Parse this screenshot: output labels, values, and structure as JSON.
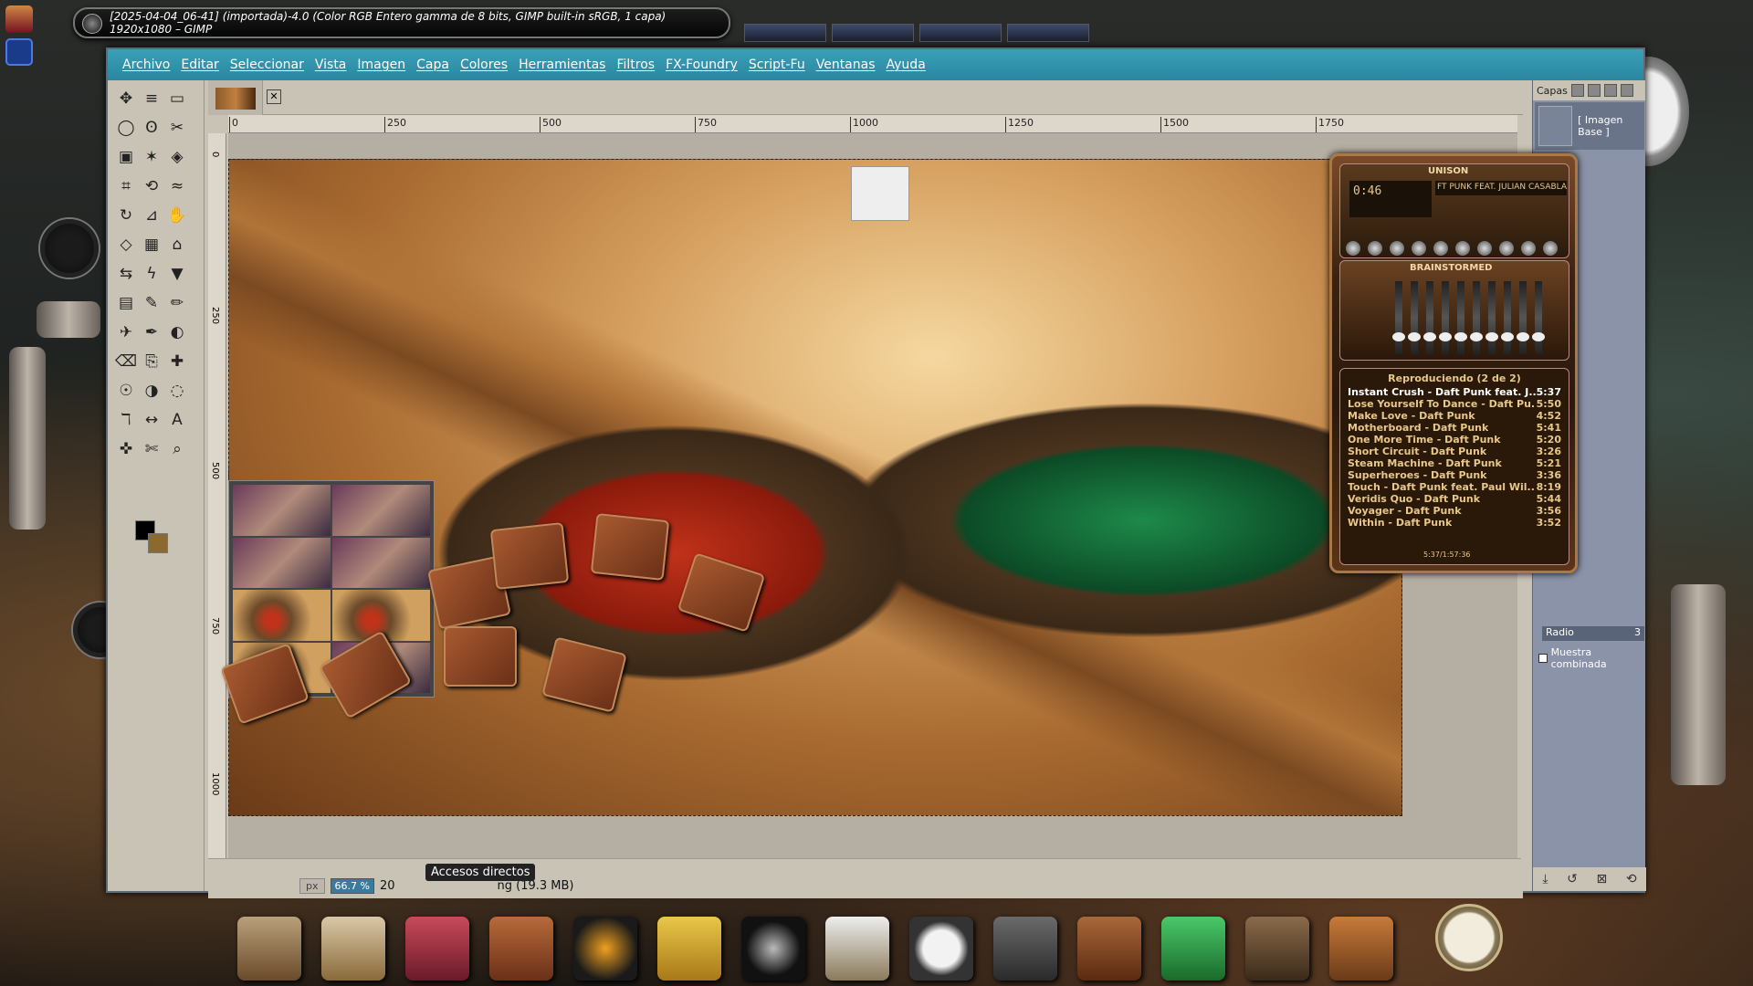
{
  "window": {
    "title": "[2025-04-04_06-41] (importada)-4.0 (Color RGB Entero gamma de 8 bits, GIMP built-in sRGB, 1 capa) 1920x1080 – GIMP"
  },
  "menu": [
    "Archivo",
    "Editar",
    "Seleccionar",
    "Vista",
    "Imagen",
    "Capa",
    "Colores",
    "Herramientas",
    "Filtros",
    "FX-Foundry",
    "Script-Fu",
    "Ventanas",
    "Ayuda"
  ],
  "ruler": {
    "h_labels": [
      "0",
      "250",
      "500",
      "750",
      "1000",
      "1250",
      "1500",
      "1750"
    ],
    "v_labels": [
      "0",
      "250",
      "500",
      "750",
      "1000"
    ]
  },
  "status": {
    "unit": "px",
    "zoom": "66.7 %",
    "info_prefix": "20",
    "info_suffix": "ng (19.3 MB)",
    "tooltip": "Accesos directos"
  },
  "dock": {
    "tab_label": "Capas",
    "layer_name": "[ Imagen Base ]",
    "radio_label": "Radio",
    "radio_value": "3",
    "sample_merged": "Muestra combinada"
  },
  "winamp": {
    "brand": "UNISON",
    "time": "0:46",
    "track_scroll": "FT PUNK FEAT. JULIAN CASABLANCAS",
    "eq_title": "BRAINSTORMED",
    "playlist_header": "Reproduciendo (2 de 2)",
    "playlist": [
      {
        "title": "Instant Crush - Daft Punk feat. J...",
        "time": "5:37",
        "current": true
      },
      {
        "title": "Lose Yourself To Dance - Daft Pu...",
        "time": "5:50"
      },
      {
        "title": "Make Love - Daft Punk",
        "time": "4:52"
      },
      {
        "title": "Motherboard - Daft Punk",
        "time": "5:41"
      },
      {
        "title": "One More Time - Daft Punk",
        "time": "5:20"
      },
      {
        "title": "Short Circuit - Daft Punk",
        "time": "3:26"
      },
      {
        "title": "Steam Machine - Daft Punk",
        "time": "5:21"
      },
      {
        "title": "Superheroes - Daft Punk",
        "time": "3:36"
      },
      {
        "title": "Touch - Daft Punk feat. Paul Wil...",
        "time": "8:19"
      },
      {
        "title": "Veridis Quo - Daft Punk",
        "time": "5:44"
      },
      {
        "title": "Voyager - Daft Punk",
        "time": "3:56"
      },
      {
        "title": "Within - Daft Punk",
        "time": "3:52"
      }
    ],
    "footer": "5:37/1:57:36"
  },
  "tools": [
    "move",
    "align",
    "rect-select",
    "ellipse-select",
    "free-select",
    "scissors",
    "fg-select",
    "fuzzy-select",
    "color-select",
    "crop",
    "unified-transform",
    "warp",
    "rotate",
    "shear",
    "handle",
    "perspective",
    "grid",
    "cage",
    "flip",
    "text-path",
    "paint-bucket",
    "blend",
    "paintbrush",
    "pencil",
    "airbrush",
    "ink",
    "mypaint",
    "eraser",
    "clone",
    "heal",
    "smudge",
    "dodge",
    "blur",
    "path",
    "measure",
    "text",
    "color-picker",
    "iscissors",
    "zoom"
  ]
}
